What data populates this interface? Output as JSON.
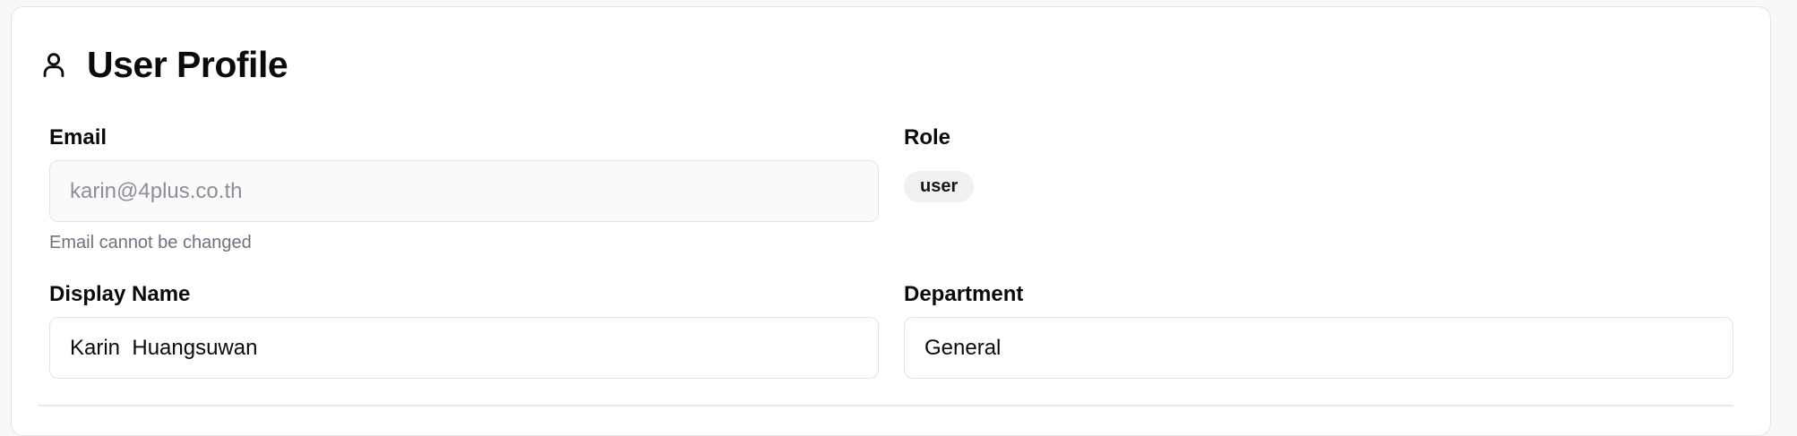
{
  "profile": {
    "title": "User Profile",
    "icon": "user-icon",
    "email": {
      "label": "Email",
      "value": "karin@4plus.co.th",
      "helper": "Email cannot be changed"
    },
    "role": {
      "label": "Role",
      "value": "user"
    },
    "display_name": {
      "label": "Display Name",
      "value": "Karin  Huangsuwan"
    },
    "department": {
      "label": "Department",
      "value": "General"
    }
  },
  "colors": {
    "border": "#e4e4e7",
    "badge_bg": "#f1f1f3",
    "helper_text": "#6b7280"
  }
}
